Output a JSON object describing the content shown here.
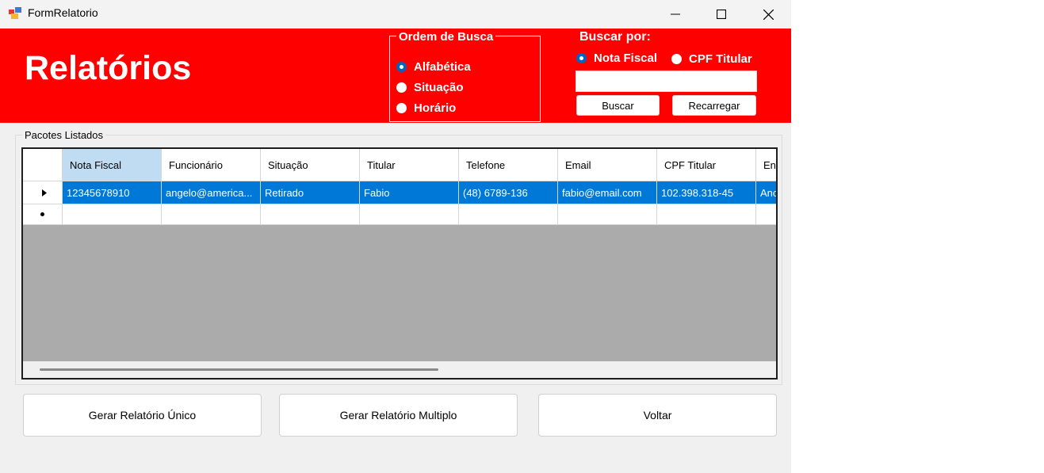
{
  "window": {
    "title": "FormRelatorio"
  },
  "header": {
    "title": "Relatórios",
    "order_group": {
      "label": "Ordem de Busca",
      "options": [
        {
          "label": "Alfabética",
          "checked": true
        },
        {
          "label": "Situação",
          "checked": false
        },
        {
          "label": "Horário",
          "checked": false
        }
      ]
    },
    "search": {
      "label": "Buscar por:",
      "options": [
        {
          "label": "Nota Fiscal",
          "checked": true
        },
        {
          "label": "CPF Titular",
          "checked": false
        }
      ],
      "value": "",
      "buscar_label": "Buscar",
      "recarregar_label": "Recarregar"
    }
  },
  "table": {
    "group_label": "Pacotes Listados",
    "columns": [
      "Nota Fiscal",
      "Funcionário",
      "Situação",
      "Titular",
      "Telefone",
      "Email",
      "CPF Titular",
      "En"
    ],
    "rows": [
      [
        "12345678910",
        "angelo@america...",
        "Retirado",
        "Fabio",
        "(48)  6789-136",
        "fabio@email.com",
        "102.398.318-45",
        "Anc"
      ]
    ]
  },
  "buttons": {
    "unico": "Gerar Relatório Único",
    "multiplo": "Gerar Relatório Multiplo",
    "voltar": "Voltar"
  },
  "colors": {
    "header_bg": "#ff0000",
    "selection": "#0078d7",
    "grid_bg": "#ababab"
  }
}
